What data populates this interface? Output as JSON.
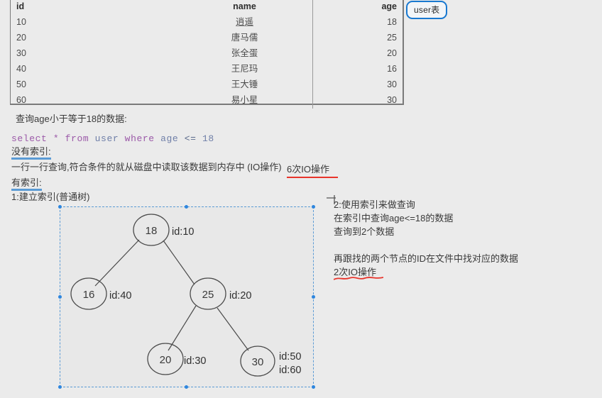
{
  "table": {
    "badge": "user表",
    "columns": [
      "id",
      "name",
      "age"
    ],
    "rows": [
      {
        "id": "10",
        "name": "逍遥",
        "age": "18"
      },
      {
        "id": "20",
        "name": "唐马儒",
        "age": "25"
      },
      {
        "id": "30",
        "name": "张全蛋",
        "age": "20"
      },
      {
        "id": "40",
        "name": "王尼玛",
        "age": "16"
      },
      {
        "id": "50",
        "name": "王大锤",
        "age": "30"
      },
      {
        "id": "60",
        "name": "易小星",
        "age": "30"
      }
    ]
  },
  "notes": {
    "query_heading": "查询age小于等于18的数据:",
    "sql": {
      "kw_select": "select",
      "star": "*",
      "kw_from": "from",
      "table_name": "user",
      "kw_where": "where",
      "column": "age",
      "operator": "<=",
      "value": "18"
    },
    "no_index_label": "没有索引:",
    "no_index_desc": "一行一行查询,符合条件的就从磁盘中读取该数据到内存中  (IO操作)",
    "no_index_cost": "6次IO操作",
    "has_index_label": "有索引:",
    "step1": "1:建立索引(普通树)",
    "step2_line1": "2:使用索引来做查询",
    "step2_line2": "在索引中查询age<=18的数据",
    "step2_line3": "查询到2个数据",
    "step3_line1": "再跟找的两个节点的ID在文件中找对应的数据",
    "step3_line2": "2次IO操作"
  },
  "tree": {
    "nodes": [
      {
        "key": "root",
        "value": "18",
        "id_label": "id:10",
        "id_label2": ""
      },
      {
        "key": "left",
        "value": "16",
        "id_label": "id:40",
        "id_label2": ""
      },
      {
        "key": "right",
        "value": "25",
        "id_label": "id:20",
        "id_label2": ""
      },
      {
        "key": "rl",
        "value": "20",
        "id_label": "id:30",
        "id_label2": ""
      },
      {
        "key": "rr",
        "value": "30",
        "id_label": "id:50",
        "id_label2": "id:60"
      }
    ]
  },
  "colors": {
    "page_bg": "#ebebeb",
    "badge_border": "#1878d0",
    "blue_underline": "#5b9bd5",
    "red_annotation": "#e8342b",
    "selection": "#2e86de",
    "sql_keyword": "#9b59a8",
    "sql_identifier": "#6f7fa8"
  }
}
